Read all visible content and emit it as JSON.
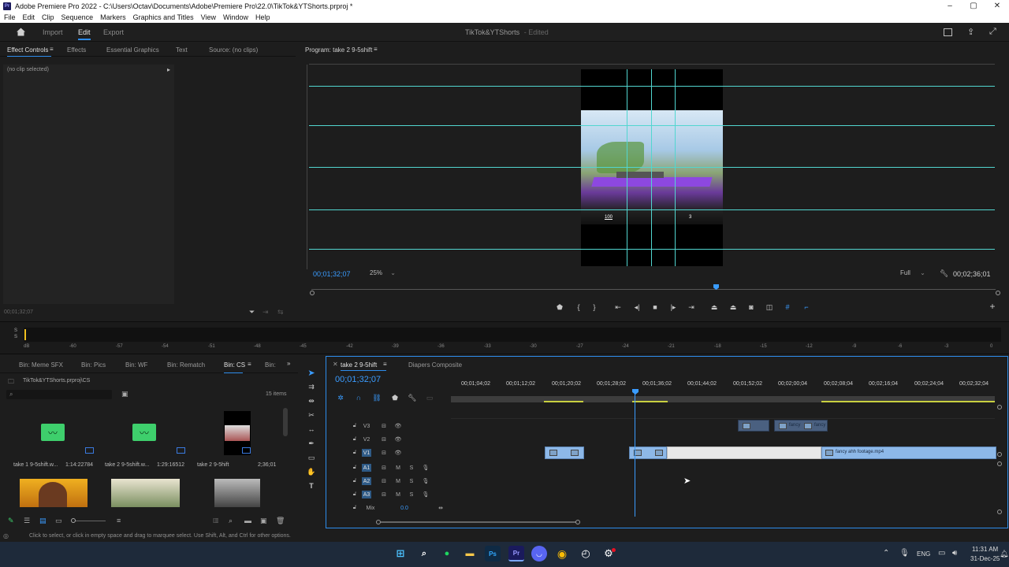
{
  "window": {
    "title": "Adobe Premiere Pro 2022 - C:\\Users\\Octav\\Documents\\Adobe\\Premiere Pro\\22.0\\TikTok&YTShorts.prproj *",
    "menu": [
      "File",
      "Edit",
      "Clip",
      "Sequence",
      "Markers",
      "Graphics and Titles",
      "View",
      "Window",
      "Help"
    ]
  },
  "header": {
    "tabs": [
      "Import",
      "Edit",
      "Export"
    ],
    "active_tab": "Edit",
    "project_name": "TikTok&YTShorts",
    "project_status": "- Edited"
  },
  "source_panel": {
    "tabs": [
      "Effect Controls",
      "Effects",
      "Essential Graphics",
      "Text",
      "Source: (no clips)"
    ],
    "no_clip_label": "(no clip selected)",
    "timecode": "00;01;32;07"
  },
  "program_monitor": {
    "title": "Program: take 2 9-5shift",
    "timecode": "00;01;32;07",
    "zoom": "25%",
    "resolution": "Full",
    "duration": "00;02;36;01",
    "hud_numbers": [
      "100",
      "3"
    ]
  },
  "audio_meter": {
    "scale": [
      "dB",
      "-60",
      "-57",
      "-54",
      "-51",
      "-48",
      "-45",
      "-42",
      "-39",
      "-36",
      "-33",
      "-30",
      "-27",
      "-24",
      "-21",
      "-18",
      "-15",
      "-12",
      "-9",
      "-6",
      "-3",
      "0"
    ],
    "solo_labels": [
      "S",
      "S"
    ]
  },
  "project_panel": {
    "tabs": [
      "Bin: Meme SFX",
      "Bin: Pics",
      "Bin: WF",
      "Bin: Rematch",
      "Bin: CS",
      "Bin:"
    ],
    "active_tab": "Bin: CS",
    "path": "TikTok&YTShorts.prproj\\CS",
    "item_count": "15 items",
    "items": [
      {
        "name": "take 1 9-5shift.w...",
        "duration": "1:14:22784"
      },
      {
        "name": "take 2 9-5shift.w...",
        "duration": "1:29:16512"
      },
      {
        "name": "take 2 9-5hift",
        "duration": "2;36;01"
      }
    ]
  },
  "timeline": {
    "tabs": [
      "take 2 9-5hift",
      "Diapers Composite"
    ],
    "timecode": "00;01;32;07",
    "ruler": [
      "00;01;04;02",
      "00;01;12;02",
      "00;01;20;02",
      "00;01;28;02",
      "00;01;36;02",
      "00;01;44;02",
      "00;01;52;02",
      "00;02;00;04",
      "00;02;08;04",
      "00;02;16;04",
      "00;02;24;04",
      "00;02;32;04"
    ],
    "video_tracks": [
      "V3",
      "V2",
      "V1"
    ],
    "audio_tracks": [
      "A1",
      "A2",
      "A3"
    ],
    "mix_label": "Mix",
    "mix_value": "0.0",
    "clip_name": "fancy ahh footage.mp4",
    "v3_labels": [
      "fancy",
      "fancy"
    ]
  },
  "status_bar": {
    "message": "Click to select, or click in empty space and drag to marquee select. Use Shift, Alt, and Ctrl for other options."
  },
  "taskbar": {
    "language": "ENG",
    "time": "11:31 AM",
    "date": "31-Dec-25"
  },
  "colors": {
    "accent": "#2d8ceb",
    "guides": "#52d6d0",
    "clip": "#8db8e8",
    "playhead": "#3a9cff"
  }
}
